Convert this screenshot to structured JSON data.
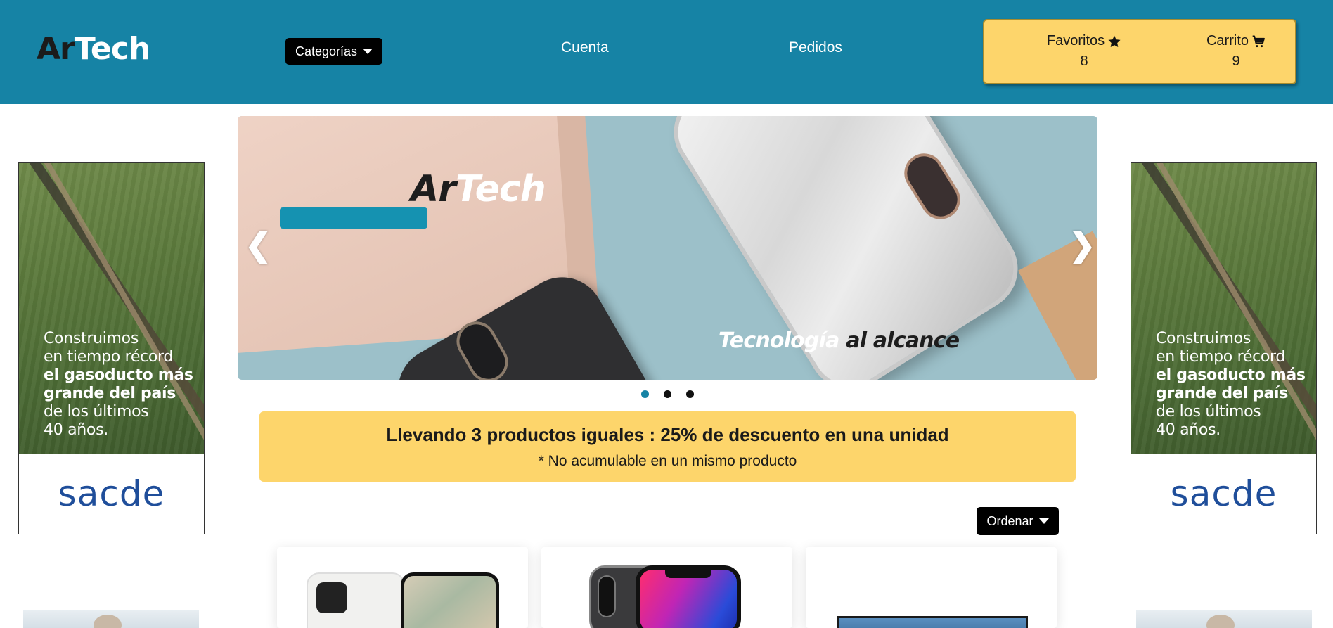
{
  "header": {
    "logo": {
      "part1": "Ar",
      "part2": "Tech"
    },
    "categories_label": "Categorías",
    "nav": {
      "account": "Cuenta",
      "orders": "Pedidos"
    },
    "favorites": {
      "label": "Favoritos",
      "count": "8"
    },
    "cart": {
      "label": "Carrito",
      "count": "9"
    }
  },
  "carousel": {
    "brand": {
      "part1": "Ar",
      "part2": "Tech"
    },
    "tagline": {
      "part1": "Tecnología",
      "part2": "al alcance"
    },
    "prev": "❮",
    "next": "❯",
    "slides": 3,
    "active_slide": 1
  },
  "ad": {
    "line1": "Construimos",
    "line2": "en tiempo récord",
    "line3": "el gasoducto más",
    "line4": "grande del país",
    "line5": "de los últimos",
    "line6": "40 años.",
    "brand": "sacde"
  },
  "promo": {
    "title": "Llevando 3 productos iguales : 25% de descuento en una unidad",
    "subtitle": "* No acumulable en un mismo producto"
  },
  "sort": {
    "label": "Ordenar"
  },
  "colors": {
    "header_bg": "#1683a5",
    "accent_yellow": "#fdd56b",
    "button_bg": "#000000",
    "dot_active": "#1683a5"
  },
  "icons": {
    "favorites": "star-icon",
    "cart": "cart-icon",
    "dropdown": "caret-down-icon"
  }
}
